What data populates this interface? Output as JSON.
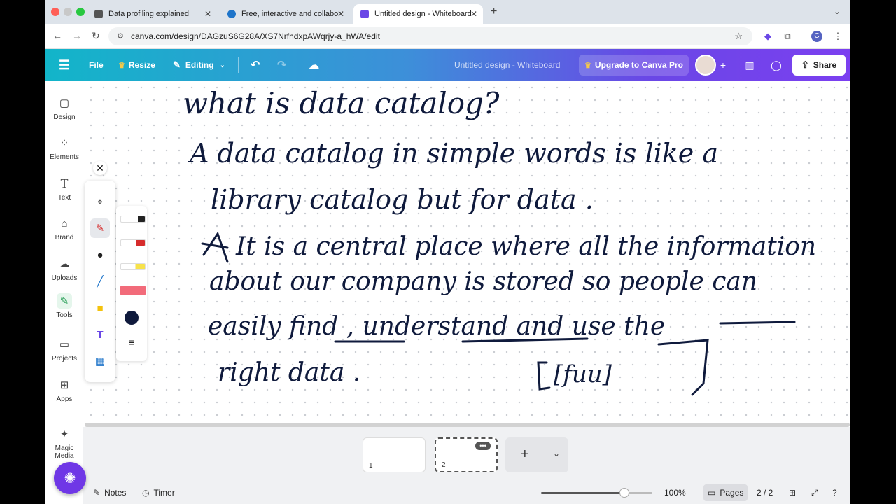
{
  "browser": {
    "tabs": [
      {
        "title": "Data profiling explained",
        "favicon_color": "#555555"
      },
      {
        "title": "Free, interactive and collabor",
        "favicon_color": "#1e74c9"
      },
      {
        "title": "Untitled design - Whiteboard",
        "favicon_color": "#6a47e6"
      }
    ],
    "new_tab": "+",
    "url": "canva.com/design/DAGzuS6G28A/XS7NrfhdxpAWqrjy-a_hWA/edit",
    "profile_initial": "C"
  },
  "header": {
    "menu_icon": "hamburger-icon",
    "file_label": "File",
    "resize_label": "Resize",
    "editing_label": "Editing",
    "doc_title": "Untitled design - Whiteboard",
    "upgrade_label": "Upgrade to Canva Pro",
    "share_label": "Share"
  },
  "sidebar": {
    "items": [
      {
        "label": "Design",
        "icon": "design-icon"
      },
      {
        "label": "Elements",
        "icon": "elements-icon"
      },
      {
        "label": "Text",
        "icon": "text-icon"
      },
      {
        "label": "Brand",
        "icon": "brand-icon"
      },
      {
        "label": "Uploads",
        "icon": "uploads-icon"
      },
      {
        "label": "Tools",
        "icon": "tools-icon"
      },
      {
        "label": "Projects",
        "icon": "projects-icon"
      },
      {
        "label": "Apps",
        "icon": "apps-icon"
      },
      {
        "label": "Magic Media",
        "icon": "magic-media-icon"
      }
    ]
  },
  "whiteboard": {
    "lines": [
      "what is data catalog?",
      "A data catalog in simple words is like a",
      "library catalog but for data .",
      "It is a central place where all the information",
      "about our company is stored so people can",
      "easily find , understand and use the",
      "right data .",
      "[fuu]"
    ]
  },
  "pages": {
    "thumbs": [
      "1",
      "2"
    ],
    "add_label": "+"
  },
  "footer": {
    "notes_label": "Notes",
    "timer_label": "Timer",
    "zoom_label": "100%",
    "zoom_level": 0.75,
    "pages_label": "Pages",
    "page_count": "2 / 2"
  }
}
